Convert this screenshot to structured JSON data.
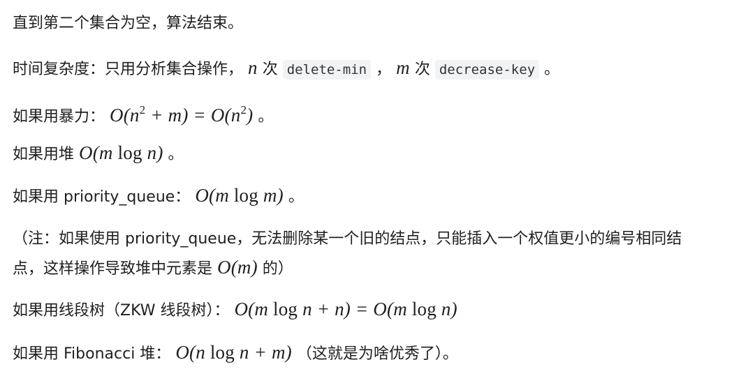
{
  "lines": {
    "l1": "直到第二个集合为空，算法结束。",
    "l2": {
      "prefix": "时间复杂度：只用分析集合操作，",
      "n_var": "n",
      "ci1": "次",
      "code1": "delete-min",
      "comma": "，",
      "m_var": "m",
      "ci2": "次",
      "code2": "decrease-key",
      "end": "。"
    },
    "l3": {
      "prefix": "如果用暴力：",
      "math_a": "O(n",
      "exp_a": "2",
      "math_b": " + m) = O(n",
      "exp_b": "2",
      "math_c": ")",
      "end": "。"
    },
    "l4": {
      "prefix": "如果用堆",
      "math_a": "O(m ",
      "log": "log",
      "math_b": " n)",
      "end": "。"
    },
    "l5": {
      "prefix": "如果用 priority_queue：",
      "math_a": "O(m ",
      "log": "log",
      "math_b": " m)",
      "end": "。"
    },
    "l6": "（注：如果使用 priority_queue，无法删除某一个旧的结点，只能插入一个权值更小的编号相同结",
    "l7": {
      "prefix": "点，这样操作导致堆中元素是",
      "math": "O(m)",
      "end": "的）"
    },
    "l8": {
      "prefix": "如果用线段树（ZKW 线段树）：",
      "math_a": "O(m ",
      "log1": "log",
      "math_b": " n + n) = O(m ",
      "log2": "log",
      "math_c": " n)"
    },
    "l9": {
      "prefix": "如果用 Fibonacci 堆：",
      "math_a": "O(n ",
      "log": "log",
      "math_b": " n + m)",
      "end": "（这就是为啥优秀了）。"
    }
  }
}
